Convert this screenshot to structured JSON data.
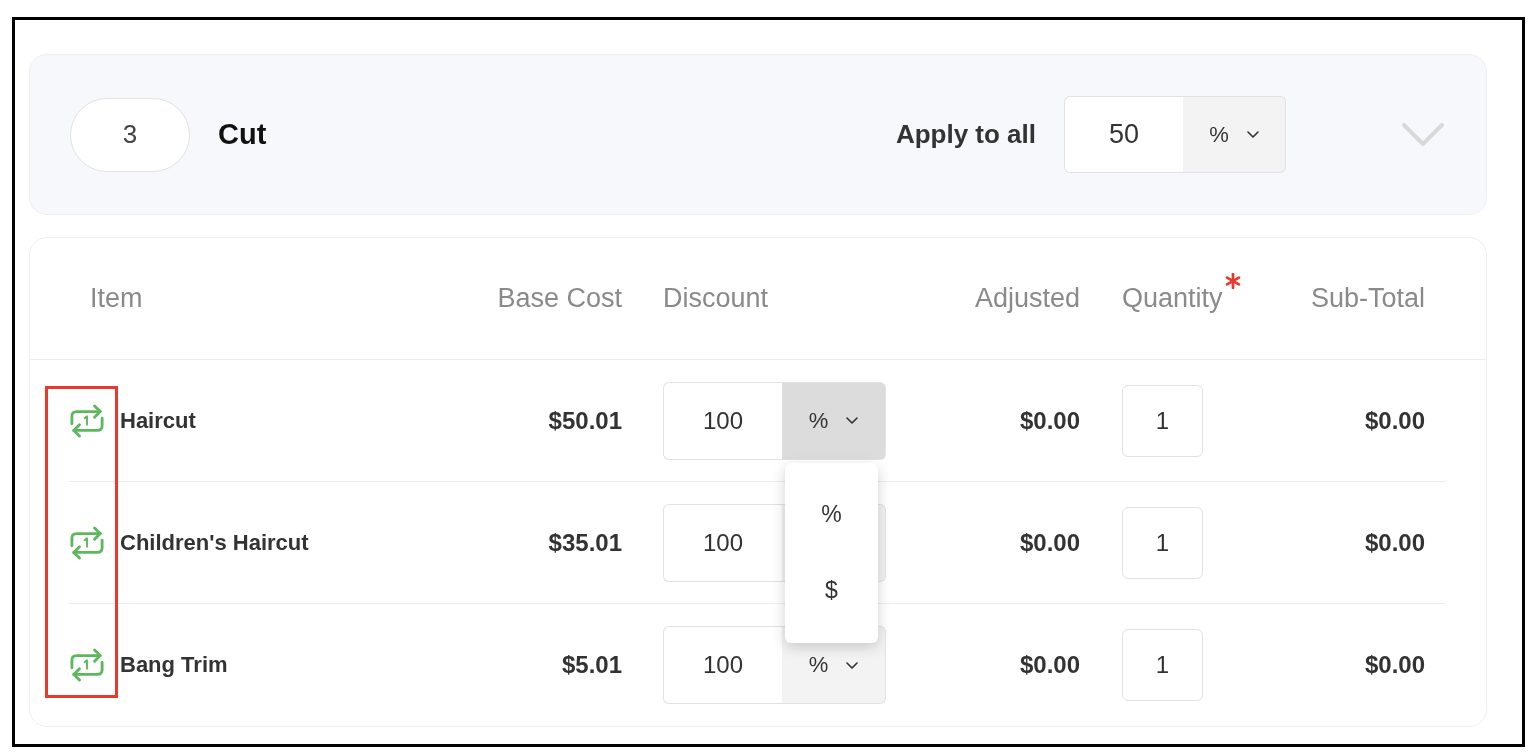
{
  "group": {
    "count": "3",
    "name": "Cut",
    "apply_label": "Apply to all",
    "apply_value": "50",
    "apply_unit": "%"
  },
  "table": {
    "columns": [
      {
        "label": "Item",
        "required": false
      },
      {
        "label": "Base Cost",
        "required": false
      },
      {
        "label": "Discount",
        "required": false
      },
      {
        "label": "Adjusted",
        "required": false
      },
      {
        "label": "Quantity",
        "required": true
      },
      {
        "label": "Sub-Total",
        "required": false
      }
    ],
    "rows": [
      {
        "item": "Haircut",
        "base_cost": "$50.01",
        "discount": "100",
        "discount_unit": "%",
        "unit_menu_open": true,
        "adjusted": "$0.00",
        "quantity": "1",
        "subtotal": "$0.00"
      },
      {
        "item": "Children's Haircut",
        "base_cost": "$35.01",
        "discount": "100",
        "unit_menu_open": false,
        "adjusted": "$0.00",
        "quantity": "1",
        "subtotal": "$0.00"
      },
      {
        "item": "Bang Trim",
        "base_cost": "$5.01",
        "discount": "100",
        "discount_unit": "%",
        "unit_menu_open": false,
        "adjusted": "$0.00",
        "quantity": "1",
        "subtotal": "$0.00"
      }
    ],
    "unit_menu": {
      "options": [
        "%",
        "$"
      ]
    }
  }
}
